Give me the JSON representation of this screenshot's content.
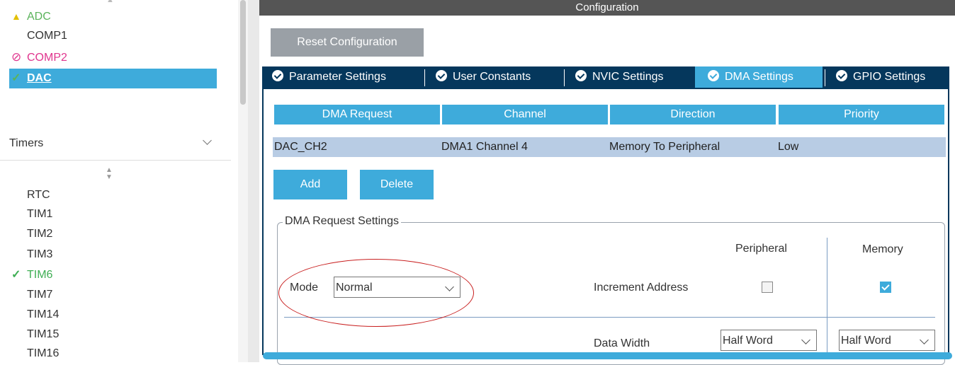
{
  "left_panel": {
    "top_items": [
      {
        "icon": "warning-icon",
        "glyph": "▲",
        "label": "ADC",
        "color": "#5bb35b",
        "icon_color": "#e3c000"
      },
      {
        "icon": "",
        "glyph": "",
        "label": "COMP1",
        "color": "#333333",
        "icon_color": ""
      },
      {
        "icon": "disabled-icon",
        "glyph": "⊘",
        "label": "COMP2",
        "color": "#e0358e",
        "icon_color": "#e0358e"
      },
      {
        "icon": "check-icon",
        "glyph": "✓",
        "label": "DAC",
        "color": "#ffffff",
        "icon_color": "#5bb35b"
      }
    ],
    "timers_header": "Timers",
    "timer_items": [
      {
        "icon": "",
        "label": "RTC",
        "color": "#333333"
      },
      {
        "icon": "",
        "label": "TIM1",
        "color": "#333333"
      },
      {
        "icon": "",
        "label": "TIM2",
        "color": "#333333"
      },
      {
        "icon": "",
        "label": "TIM3",
        "color": "#333333"
      },
      {
        "icon": "check-icon",
        "label": "TIM6",
        "color": "#3fae54"
      },
      {
        "icon": "",
        "label": "TIM7",
        "color": "#333333"
      },
      {
        "icon": "",
        "label": "TIM14",
        "color": "#333333"
      },
      {
        "icon": "",
        "label": "TIM15",
        "color": "#333333"
      },
      {
        "icon": "",
        "label": "TIM16",
        "color": "#333333"
      }
    ]
  },
  "config": {
    "title": "Configuration",
    "reset_button": "Reset Configuration",
    "tabs": [
      {
        "label": "Parameter Settings",
        "active": false
      },
      {
        "label": "User Constants",
        "active": false
      },
      {
        "label": "NVIC Settings",
        "active": false
      },
      {
        "label": "DMA Settings",
        "active": true
      },
      {
        "label": "GPIO Settings",
        "active": false
      }
    ],
    "table": {
      "headers": [
        "DMA Request",
        "Channel",
        "Direction",
        "Priority"
      ],
      "rows": [
        [
          "DAC_CH2",
          "DMA1 Channel 4",
          "Memory To Peripheral",
          "Low"
        ]
      ]
    },
    "add_button": "Add",
    "delete_button": "Delete",
    "request_settings": {
      "title": "DMA Request Settings",
      "mode_label": "Mode",
      "mode_value": "Normal",
      "peripheral_header": "Peripheral",
      "memory_header": "Memory",
      "increment_label": "Increment Address",
      "peripheral_increment": false,
      "memory_increment": true,
      "data_width_label": "Data Width",
      "peripheral_data_width": "Half Word",
      "memory_data_width": "Half Word"
    }
  },
  "colors": {
    "accent": "#3eabdb",
    "tabbar": "#05375c",
    "highlight": "#c81e1e"
  }
}
